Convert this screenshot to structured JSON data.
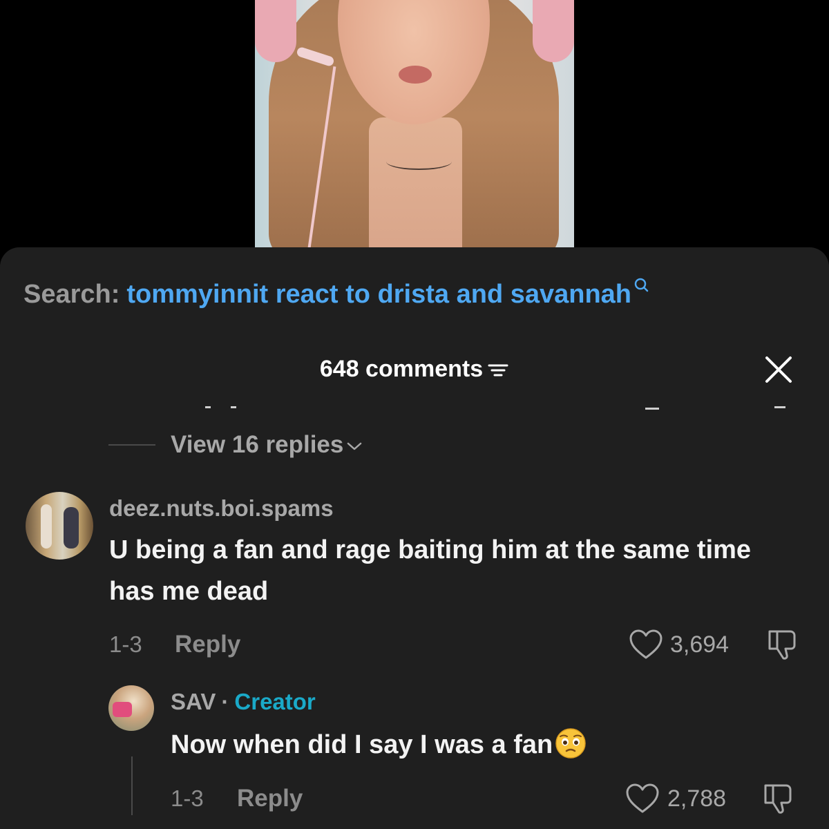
{
  "search": {
    "label": "Search:",
    "query": "tommyinnit react to drista and savannah"
  },
  "comments_header": {
    "title": "648 comments"
  },
  "thread": {
    "view_replies_label": "View 16 replies"
  },
  "comments": [
    {
      "username": "deez.nuts.boi.spams",
      "text": "U being a fan and rage baiting him at the same time has me dead",
      "date": "1-3",
      "reply_label": "Reply",
      "likes": "3,694"
    },
    {
      "username": "SAV",
      "separator": "·",
      "badge": "Creator",
      "text": "Now when did I say I was a fan",
      "emoji": "pleading-face",
      "date": "1-3",
      "reply_label": "Reply",
      "likes": "2,788"
    }
  ],
  "colors": {
    "sheet_bg": "#1f1f1f",
    "search_query": "#4fa8f2",
    "creator_badge": "#1aa9c8",
    "muted_text": "#a8a8a8"
  }
}
